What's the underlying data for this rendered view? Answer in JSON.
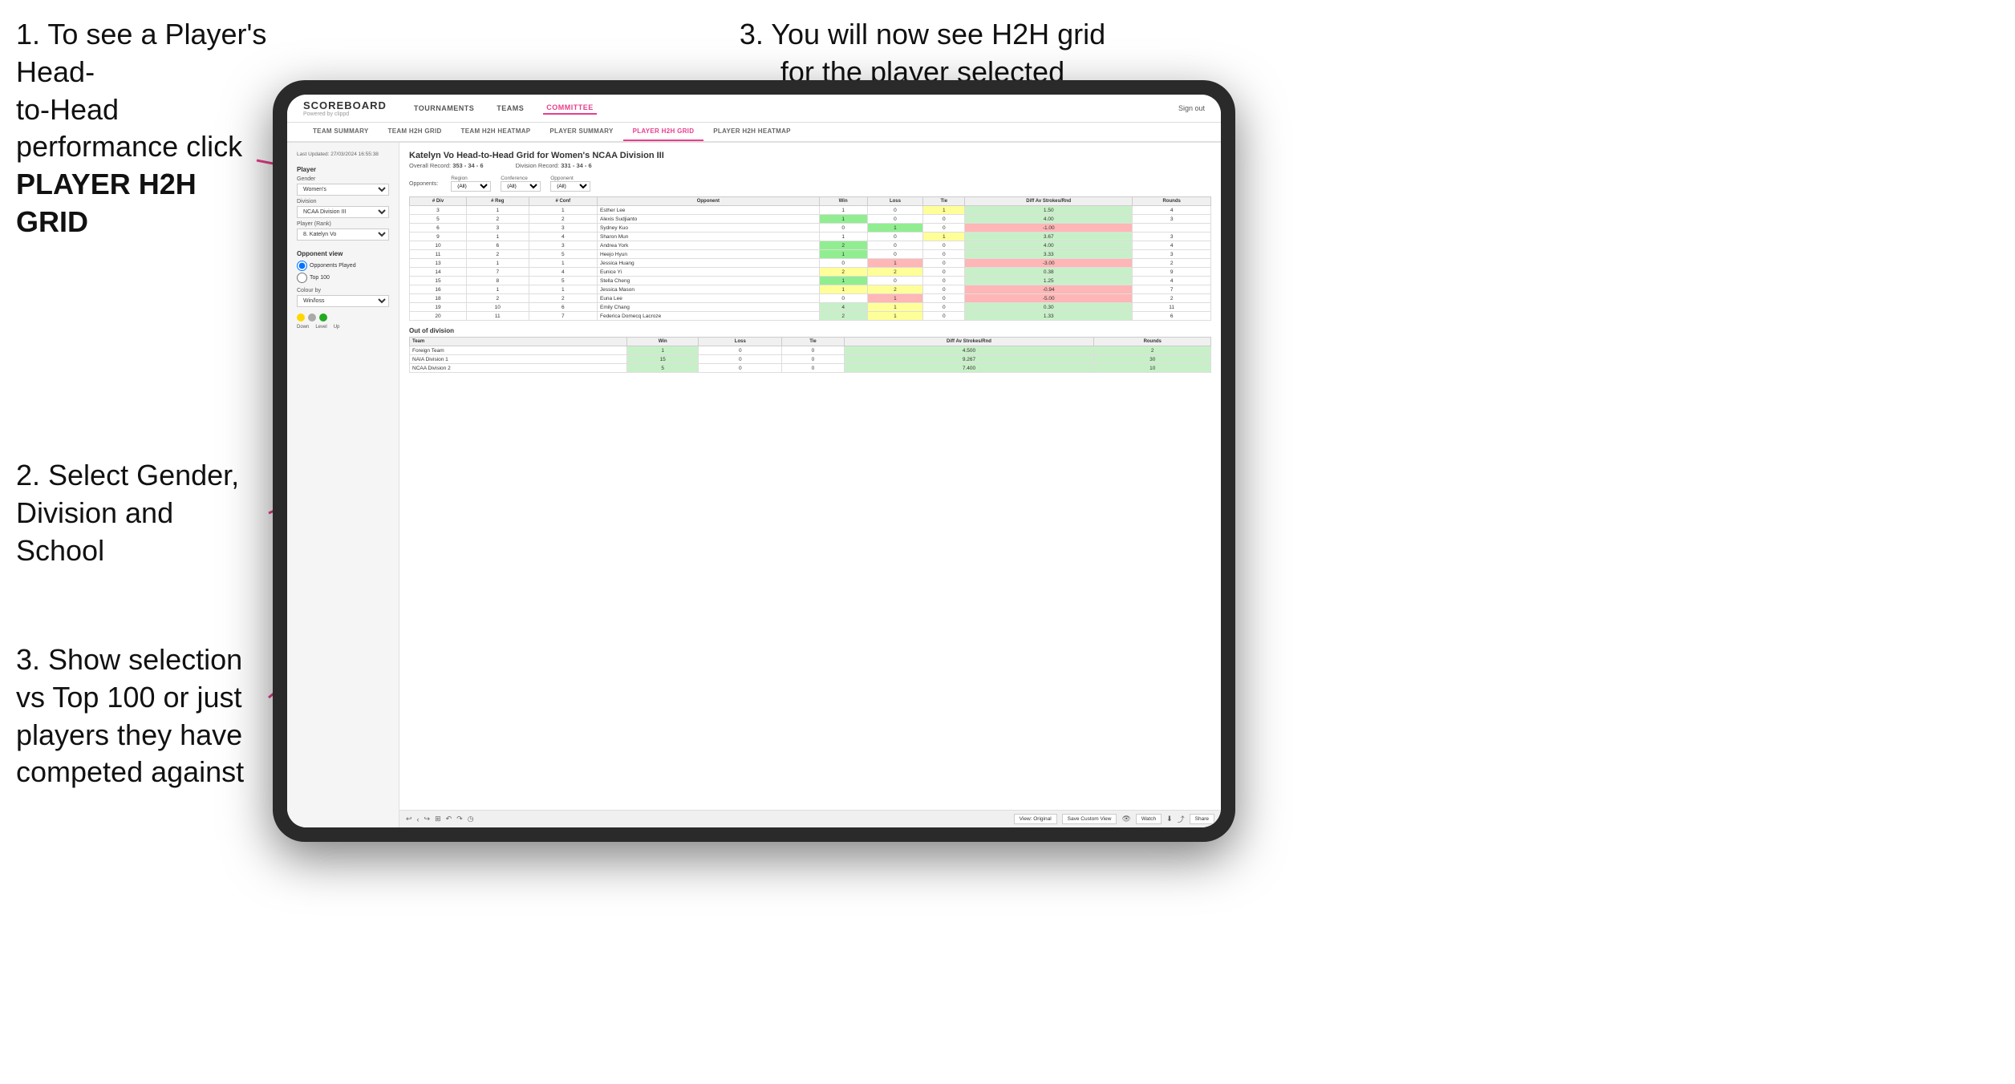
{
  "instructions": {
    "step1_line1": "1. To see a Player's Head-",
    "step1_line2": "to-Head performance click",
    "step1_bold": "PLAYER H2H GRID",
    "step2_line1": "2. Select Gender,",
    "step2_line2": "Division and",
    "step2_line3": "School",
    "step3_right_line1": "3. You will now see H2H grid",
    "step3_right_line2": "for the player selected",
    "step3_bottom_line1": "3. Show selection",
    "step3_bottom_line2": "vs Top 100 or just",
    "step3_bottom_line3": "players they have",
    "step3_bottom_line4": "competed against"
  },
  "nav": {
    "logo_main": "SCOREBOARD",
    "logo_sub": "Powered by clippd",
    "items": [
      "TOURNAMENTS",
      "TEAMS",
      "COMMITTEE"
    ],
    "sign_out": "Sign out"
  },
  "sub_nav": {
    "items": [
      "TEAM SUMMARY",
      "TEAM H2H GRID",
      "TEAM H2H HEATMAP",
      "PLAYER SUMMARY",
      "PLAYER H2H GRID",
      "PLAYER H2H HEATMAP"
    ]
  },
  "sidebar": {
    "timestamp": "Last Updated: 27/03/2024\n16:55:38",
    "player_label": "Player",
    "gender_label": "Gender",
    "gender_value": "Women's",
    "division_label": "Division",
    "division_value": "NCAA Division III",
    "player_rank_label": "Player (Rank)",
    "player_rank_value": "8. Katelyn Vo",
    "opponent_view_label": "Opponent view",
    "radio1": "Opponents Played",
    "radio2": "Top 100",
    "colour_by_label": "Colour by",
    "colour_by_value": "Win/loss",
    "colour_down": "Down",
    "colour_level": "Level",
    "colour_up": "Up"
  },
  "content": {
    "title": "Katelyn Vo Head-to-Head Grid for Women's NCAA Division III",
    "overall_record_label": "Overall Record:",
    "overall_record": "353 - 34 - 6",
    "division_record_label": "Division Record:",
    "division_record": "331 - 34 - 6",
    "filters": {
      "region_label": "Region",
      "conference_label": "Conference",
      "opponent_label": "Opponent",
      "opponents_label": "Opponents:",
      "region_value": "(All)",
      "conference_value": "(All)",
      "opponent_value": "(All)"
    },
    "table_headers": [
      "# Div",
      "# Reg",
      "# Conf",
      "Opponent",
      "Win",
      "Loss",
      "Tie",
      "Diff Av Strokes/Rnd",
      "Rounds"
    ],
    "rows": [
      {
        "div": "3",
        "reg": "1",
        "conf": "1",
        "opponent": "Esther Lee",
        "win": "1",
        "loss": "0",
        "tie": "1",
        "diff": "1.50",
        "rounds": "4",
        "win_color": "white",
        "loss_color": "white",
        "tie_color": "yellow"
      },
      {
        "div": "5",
        "reg": "2",
        "conf": "2",
        "opponent": "Alexis Sudjianto",
        "win": "1",
        "loss": "0",
        "tie": "0",
        "diff": "4.00",
        "rounds": "3",
        "win_color": "green",
        "loss_color": "white",
        "tie_color": "white"
      },
      {
        "div": "6",
        "reg": "3",
        "conf": "3",
        "opponent": "Sydney Kuo",
        "win": "0",
        "loss": "1",
        "tie": "0",
        "diff": "-1.00",
        "rounds": "",
        "win_color": "white",
        "loss_color": "green",
        "tie_color": "white"
      },
      {
        "div": "9",
        "reg": "1",
        "conf": "4",
        "opponent": "Sharon Mun",
        "win": "1",
        "loss": "0",
        "tie": "1",
        "diff": "3.67",
        "rounds": "3",
        "win_color": "white",
        "loss_color": "white",
        "tie_color": "yellow"
      },
      {
        "div": "10",
        "reg": "6",
        "conf": "3",
        "opponent": "Andrea York",
        "win": "2",
        "loss": "0",
        "tie": "0",
        "diff": "4.00",
        "rounds": "4",
        "win_color": "green",
        "loss_color": "white",
        "tie_color": "white"
      },
      {
        "div": "11",
        "reg": "2",
        "conf": "5",
        "opponent": "Heejo Hyun",
        "win": "1",
        "loss": "0",
        "tie": "0",
        "diff": "3.33",
        "rounds": "3",
        "win_color": "green",
        "loss_color": "white",
        "tie_color": "white"
      },
      {
        "div": "13",
        "reg": "1",
        "conf": "1",
        "opponent": "Jessica Huang",
        "win": "0",
        "loss": "1",
        "tie": "0",
        "diff": "-3.00",
        "rounds": "2",
        "win_color": "white",
        "loss_color": "red",
        "tie_color": "white"
      },
      {
        "div": "14",
        "reg": "7",
        "conf": "4",
        "opponent": "Eunice Yi",
        "win": "2",
        "loss": "2",
        "tie": "0",
        "diff": "0.38",
        "rounds": "9",
        "win_color": "yellow",
        "loss_color": "yellow",
        "tie_color": "white"
      },
      {
        "div": "15",
        "reg": "8",
        "conf": "5",
        "opponent": "Stella Cheng",
        "win": "1",
        "loss": "0",
        "tie": "0",
        "diff": "1.25",
        "rounds": "4",
        "win_color": "green",
        "loss_color": "white",
        "tie_color": "white"
      },
      {
        "div": "16",
        "reg": "1",
        "conf": "1",
        "opponent": "Jessica Mason",
        "win": "1",
        "loss": "2",
        "tie": "0",
        "diff": "-0.94",
        "rounds": "7",
        "win_color": "yellow",
        "loss_color": "yellow",
        "tie_color": "white"
      },
      {
        "div": "18",
        "reg": "2",
        "conf": "2",
        "opponent": "Euna Lee",
        "win": "0",
        "loss": "1",
        "tie": "0",
        "diff": "-5.00",
        "rounds": "2",
        "win_color": "white",
        "loss_color": "red",
        "tie_color": "white"
      },
      {
        "div": "19",
        "reg": "10",
        "conf": "6",
        "opponent": "Emily Chang",
        "win": "4",
        "loss": "1",
        "tie": "0",
        "diff": "0.30",
        "rounds": "11",
        "win_color": "light-green",
        "loss_color": "yellow",
        "tie_color": "white"
      },
      {
        "div": "20",
        "reg": "11",
        "conf": "7",
        "opponent": "Federica Domecq Lacroze",
        "win": "2",
        "loss": "1",
        "tie": "0",
        "diff": "1.33",
        "rounds": "6",
        "win_color": "light-green",
        "loss_color": "yellow",
        "tie_color": "white"
      }
    ],
    "out_of_division_title": "Out of division",
    "out_of_division_rows": [
      {
        "team": "Foreign Team",
        "win": "1",
        "loss": "0",
        "tie": "0",
        "diff": "4.500",
        "rounds": "2"
      },
      {
        "team": "NAIA Division 1",
        "win": "15",
        "loss": "0",
        "tie": "0",
        "diff": "9.267",
        "rounds": "30"
      },
      {
        "team": "NCAA Division 2",
        "win": "5",
        "loss": "0",
        "tie": "0",
        "diff": "7.400",
        "rounds": "10"
      }
    ]
  },
  "toolbar": {
    "view_original": "View: Original",
    "save_custom_view": "Save Custom View",
    "watch": "Watch",
    "share": "Share"
  }
}
